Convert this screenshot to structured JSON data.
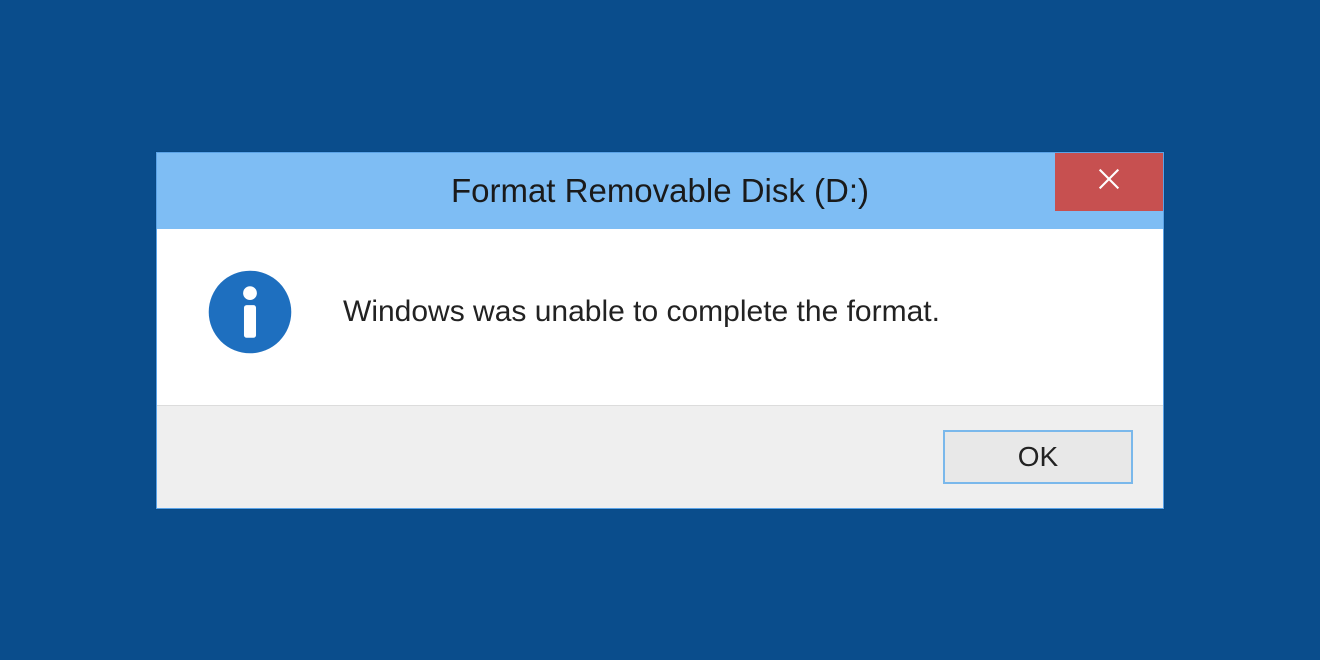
{
  "dialog": {
    "title": "Format Removable Disk (D:)",
    "message": "Windows was unable to complete the format.",
    "ok_label": "OK"
  },
  "colors": {
    "background": "#0a4d8c",
    "titlebar": "#7ebdf4",
    "close": "#c75050",
    "info_icon": "#1e6fbf"
  }
}
